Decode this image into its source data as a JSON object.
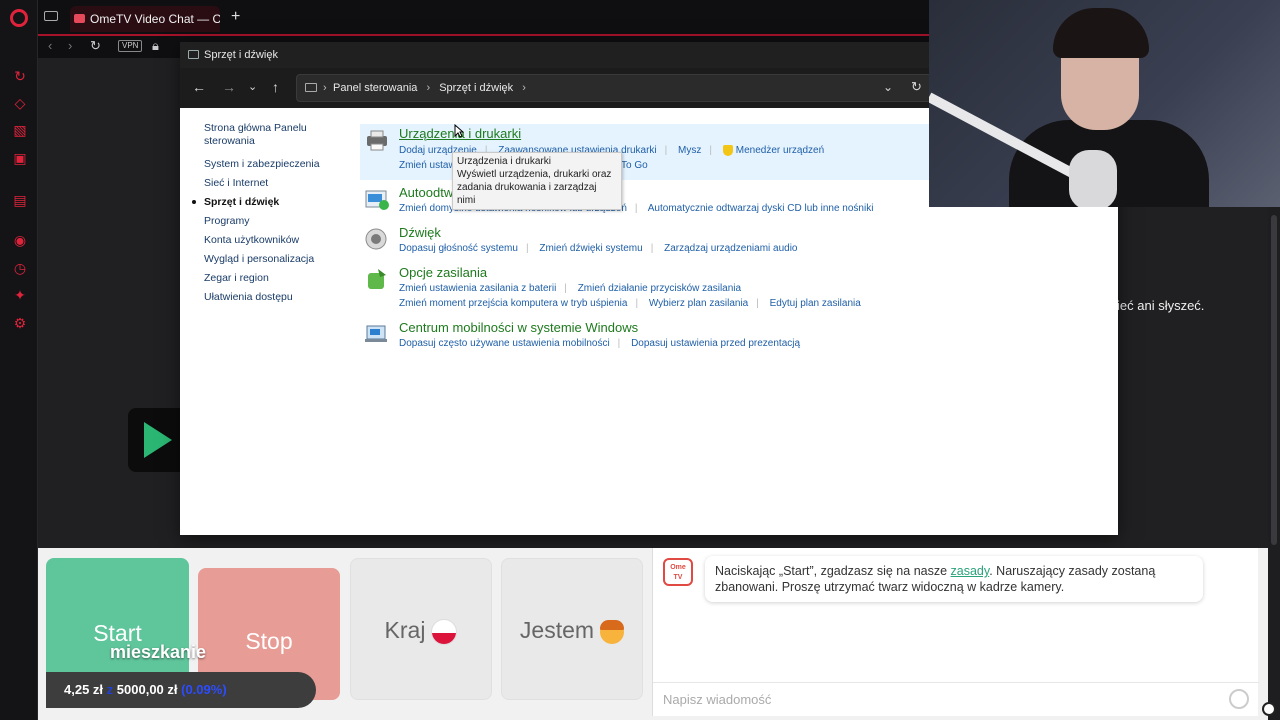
{
  "browser": {
    "tab_title": "OmeTV Video Chat — Ome",
    "vpn_badge": "VPN",
    "new_tab_symbol": "+"
  },
  "window": {
    "title": "Sprzęt i dźwięk",
    "breadcrumb": [
      "Panel sterowania",
      "Sprzęt i dźwięk"
    ]
  },
  "leftnav": {
    "home": "Strona główna Panelu sterowania",
    "items": [
      "System i zabezpieczenia",
      "Sieć i Internet",
      "Sprzęt i dźwięk",
      "Programy",
      "Konta użytkowników",
      "Wygląd i personalizacja",
      "Zegar i region",
      "Ułatwienia dostępu"
    ]
  },
  "categories": {
    "devices": {
      "title": "Urządzenia i drukarki",
      "line1": [
        "Dodaj urządzenie",
        "Zaawansowane ustawienia drukarki",
        "Mysz",
        "Menedżer urządzeń"
      ],
      "line2_start": "Zmień ustaw",
      "line2_end": "To Go"
    },
    "autoplay": {
      "title": "Autoodtwarzanie",
      "line1": [
        "Zmień domyślne ustawienia nośników lub urządzeń",
        "Automatycznie odtwarzaj dyski CD lub inne nośniki"
      ]
    },
    "sound": {
      "title": "Dźwięk",
      "line1": [
        "Dopasuj głośność systemu",
        "Zmień dźwięki systemu",
        "Zarządzaj urządzeniami audio"
      ]
    },
    "power": {
      "title": "Opcje zasilania",
      "line1": [
        "Zmień ustawienia zasilania z baterii",
        "Zmień działanie przycisków zasilania"
      ],
      "line2": [
        "Zmień moment przejścia komputera w tryb uśpienia",
        "Wybierz plan zasilania",
        "Edytuj plan zasilania"
      ]
    },
    "mobility": {
      "title": "Centrum mobilności w systemie Windows",
      "line1": [
        "Dopasuj często używane ustawienia mobilności",
        "Dopasuj ustawienia przed prezentacją"
      ]
    }
  },
  "tooltip": {
    "title": "Urządzenia i drukarki",
    "body": "Wyświetl urządzenia, drukarki oraz zadania drukowania i zarządzaj nimi"
  },
  "page": {
    "bg_text": "ieć ani słyszeć."
  },
  "controls": {
    "start": "Start",
    "stop": "Stop",
    "country": "Kraj",
    "gender": "Jestem",
    "overlay": "mieszkanie",
    "savings_current": "4,25 zł",
    "savings_of": "z",
    "savings_target": "5000,00 zł",
    "savings_pct": "(0.09%)"
  },
  "chat": {
    "logo_top": "Ome",
    "logo_bottom": "TV",
    "msg_before": "Naciskając „Start”, zgadzasz się na nasze",
    "msg_link": "zasady",
    "msg_after": ". Naruszający zasady zostaną zbanowani. Proszę utrzymać twarz widoczną w kadrze kamery.",
    "input_placeholder": "Napisz wiadomość"
  },
  "colors": {
    "accent": "#e0233b",
    "start": "#5fc59b",
    "stop": "#e79c95",
    "cp_green": "#1e7a1e",
    "cp_link": "#1f5fa7"
  }
}
